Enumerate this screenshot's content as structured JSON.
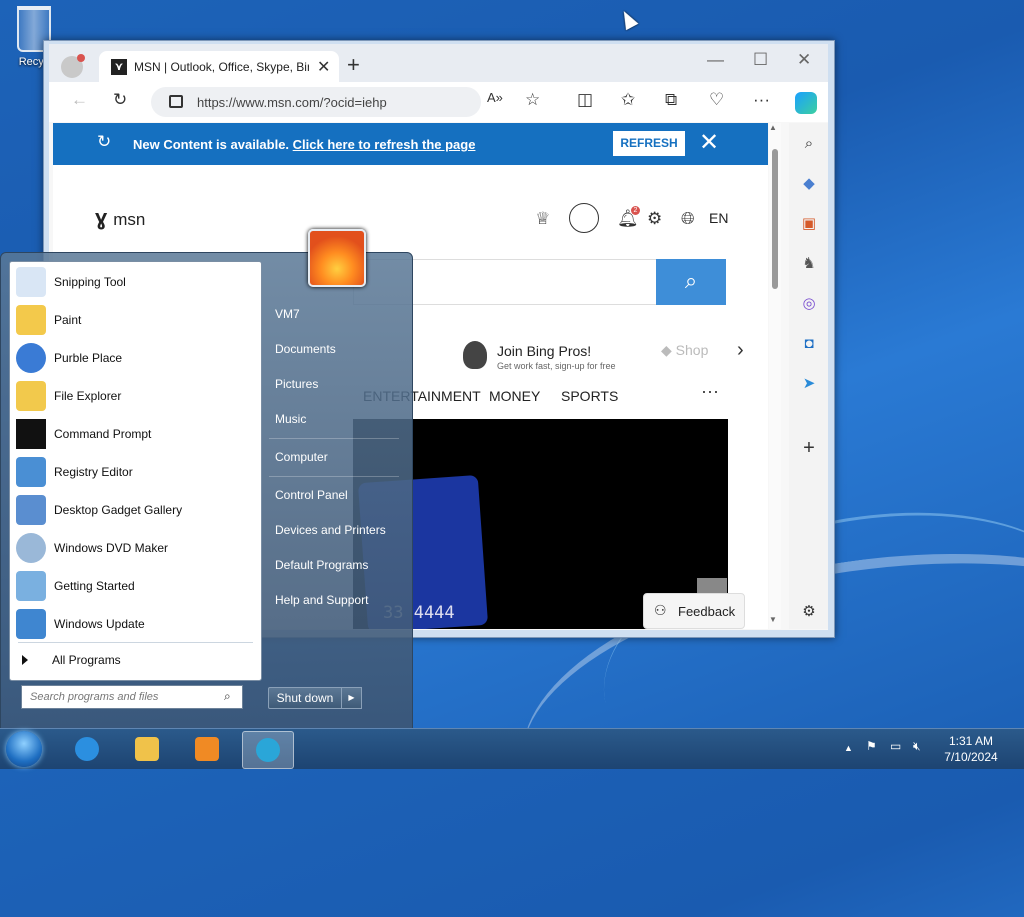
{
  "desktop": {
    "recycle_bin_label": "Recyc"
  },
  "browser": {
    "tab_title": "MSN | Outlook, Office, Skype, Bing",
    "tab_favicon": "msn-icon",
    "url": "https://www.msn.com/?ocid=iehp",
    "window_controls": {
      "minimize": "—",
      "maximize": "☐",
      "close": "✕"
    },
    "toolbar_icons": [
      "back-icon",
      "refresh-icon",
      "read-aloud-icon",
      "favorite-star-icon",
      "split-screen-icon",
      "favorites-icon",
      "collections-icon",
      "browser-essentials-icon",
      "more-icon",
      "copilot-icon"
    ]
  },
  "msn": {
    "banner": {
      "text": "New Content is available.",
      "link": "Click here to refresh the page",
      "button": "REFRESH",
      "close": "✕"
    },
    "logo_text": "msn",
    "bell_badge": "2",
    "language": "EN",
    "promo_title": "Join Bing Pros!",
    "promo_sub": "Get work fast, sign-up for free",
    "shop_label": "Shop",
    "nav": [
      "ENTERTAINMENT",
      "MONEY",
      "SPORTS"
    ],
    "nav_more": "···",
    "card_number": "33 4444",
    "feedback": "Feedback"
  },
  "sidebar_icons": [
    "search-icon",
    "tag-icon",
    "toolbox-icon",
    "chess-icon",
    "m365-icon",
    "outlook-icon",
    "telegram-icon",
    "add-icon",
    "settings-icon"
  ],
  "start_menu": {
    "programs": [
      {
        "label": "Snipping Tool",
        "icon": "snipping-tool-icon",
        "color": "#d9e6f5"
      },
      {
        "label": "Paint",
        "icon": "paint-icon",
        "color": "#f3c94b"
      },
      {
        "label": "Purble Place",
        "icon": "purble-place-icon",
        "color": "#3a7bd5"
      },
      {
        "label": "File Explorer",
        "icon": "folder-icon",
        "color": "#f2c94c"
      },
      {
        "label": "Command Prompt",
        "icon": "command-prompt-icon",
        "color": "#111111"
      },
      {
        "label": "Registry Editor",
        "icon": "registry-editor-icon",
        "color": "#4a8fd4"
      },
      {
        "label": "Desktop Gadget Gallery",
        "icon": "gadget-gallery-icon",
        "color": "#5a8ed0"
      },
      {
        "label": "Windows DVD Maker",
        "icon": "dvd-maker-icon",
        "color": "#9ab8d8"
      },
      {
        "label": "Getting Started",
        "icon": "getting-started-icon",
        "color": "#7ab0e0"
      },
      {
        "label": "Windows Update",
        "icon": "windows-update-icon",
        "color": "#3f86d0"
      }
    ],
    "all_programs": "All Programs",
    "search_placeholder": "Search programs and files",
    "right_items": [
      "VM7",
      "Documents",
      "Pictures",
      "Music",
      "Computer",
      "Control Panel",
      "Devices and Printers",
      "Default Programs",
      "Help and Support"
    ],
    "shutdown": "Shut down"
  },
  "taskbar": {
    "apps": [
      {
        "name": "internet-explorer-icon",
        "color": "#2b8fe0"
      },
      {
        "name": "explorer-folder-icon",
        "color": "#f0c24a"
      },
      {
        "name": "media-player-icon",
        "color": "#f08a24"
      },
      {
        "name": "edge-icon",
        "color": "#2aa6d8"
      }
    ],
    "time": "1:31 AM",
    "date": "7/10/2024"
  }
}
